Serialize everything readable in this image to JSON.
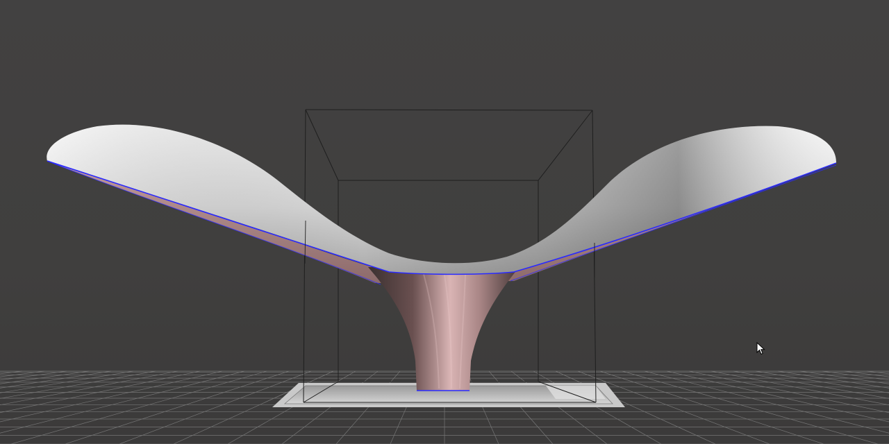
{
  "viewport": {
    "background_color": "#414040",
    "grid_color": "#8a8a8a",
    "build_plate_color": "#d2d2d2",
    "build_volume_line_color": "#1e1e1e",
    "model_top_color": "#e4e4e4",
    "model_underside_color": "#b98f8f",
    "model_edge_color": "#2a2aff"
  },
  "model": {
    "name": "curved-shell-vase",
    "visible": true
  },
  "cursor": {
    "icon": "arrow-cursor-icon"
  }
}
